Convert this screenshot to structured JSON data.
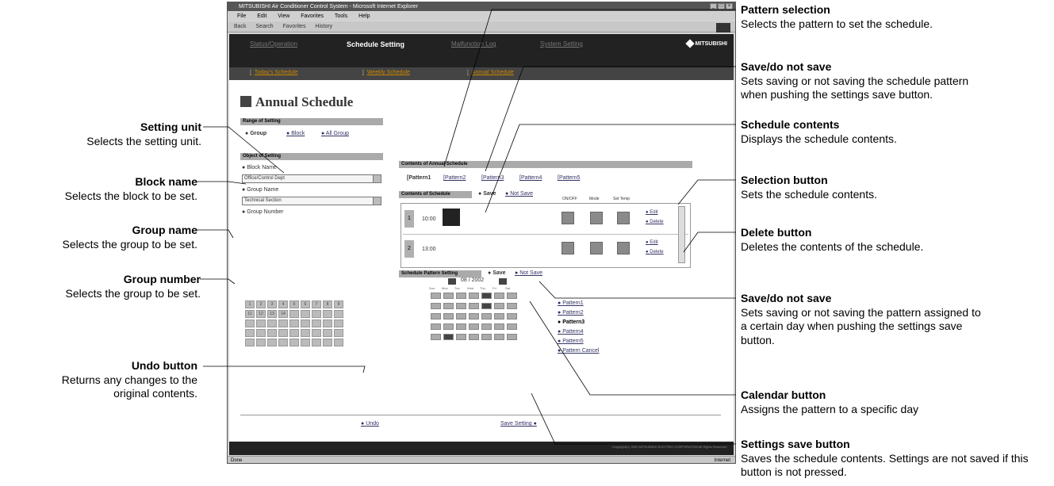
{
  "callouts_left": [
    {
      "title": "Setting unit",
      "desc": "Selects the setting unit."
    },
    {
      "title": "Block name",
      "desc": "Selects the block to be set."
    },
    {
      "title": "Group name",
      "desc": "Selects the group to be set."
    },
    {
      "title": "Group number",
      "desc": "Selects the group to be set."
    },
    {
      "title": "Undo button",
      "desc": "Returns any changes to the original contents."
    }
  ],
  "callouts_right": [
    {
      "title": "Pattern selection",
      "desc": "Selects the pattern to set the schedule."
    },
    {
      "title": "Save/do not save",
      "desc": "Sets saving or not saving the schedule pattern when pushing the settings save button."
    },
    {
      "title": "Schedule contents",
      "desc": "Displays the schedule contents."
    },
    {
      "title": "Selection button",
      "desc": "Sets the schedule contents."
    },
    {
      "title": "Delete button",
      "desc": "Deletes the contents of the schedule."
    },
    {
      "title": "Save/do not save",
      "desc": "Sets saving or not saving the pattern assigned to a certain day when pushing the settings save button."
    },
    {
      "title": "Calendar button",
      "desc": "Assigns the pattern to a specific day"
    },
    {
      "title": "Settings save button",
      "desc": "Saves the schedule contents. Settings are not saved if this button is not pressed."
    }
  ],
  "window": {
    "title": "MITSUBISHI Air Conditioner Control System - Microsoft Internet Explorer",
    "menu": [
      "File",
      "Edit",
      "View",
      "Favorites",
      "Tools",
      "Help"
    ],
    "toolbar": [
      "Back",
      "Search",
      "Favorites",
      "History"
    ],
    "status_left": "Done",
    "status_right": "Internet"
  },
  "nav": {
    "items": [
      "Status/Operation",
      "Schedule Setting",
      "Malfunction Log",
      "System Setting"
    ],
    "active": "Schedule Setting",
    "brand": "MITSUBISHI",
    "sub": [
      "Today's Schedule",
      "Weekly Schedule",
      "Annual Schedule"
    ]
  },
  "page": {
    "heading": "Annual Schedule",
    "range_title": "Range of Setting",
    "range_options": [
      "Group",
      "Block",
      "All Group"
    ],
    "object_title": "Object of Setting",
    "block_label": "Block Name",
    "block_value": "Office/Control Dept",
    "group_label": "Group Name",
    "group_value": "Technical Section",
    "group_number_label": "Group Number",
    "group_numbers": [
      "1",
      "2",
      "3",
      "4",
      "5",
      "6",
      "7",
      "8",
      "9",
      "11",
      "12",
      "13",
      "14"
    ],
    "contents_title": "Contents of Annual Schedule",
    "patterns": [
      "[Pattern1",
      "[Pattern2",
      "[Pattern3",
      "[Pattern4",
      "[Pattern5"
    ],
    "contents_sub": "Contents of Schedule",
    "save": "Save",
    "not_save": "Not Save",
    "col_heads": [
      "ON/OFF",
      "Mode",
      "Set Temp"
    ],
    "rows": [
      {
        "num": "1",
        "time": "10:00"
      },
      {
        "num": "2",
        "time": "13:00"
      }
    ],
    "edit": "Edit",
    "delete": "Delete",
    "pattern_setting_title": "Schedule Pattern Setting",
    "month": "08 / 2002",
    "weekdays": [
      "Sun",
      "Mon",
      "Tue",
      "Wed",
      "Thu",
      "Fri",
      "Sat"
    ],
    "day_patterns": [
      "Pattern1",
      "Pattern2",
      "Pattern3",
      "Pattern4",
      "Pattern5",
      "Pattern Cancel"
    ],
    "undo": "Undo",
    "save_setting": "Save Setting",
    "copyright": "Copyright(C) 2002 MITSUBISHI ELECTRIC CORPORATION All Rights Reserved."
  }
}
